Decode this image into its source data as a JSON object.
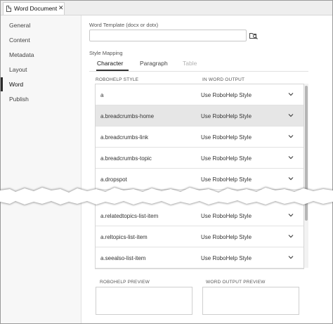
{
  "window": {
    "tab_title": "Word Document",
    "close_glyph": "✕"
  },
  "sidebar": {
    "items": [
      {
        "label": "General",
        "active": false
      },
      {
        "label": "Content",
        "active": false
      },
      {
        "label": "Metadata",
        "active": false
      },
      {
        "label": "Layout",
        "active": false
      },
      {
        "label": "Word",
        "active": true
      },
      {
        "label": "Publish",
        "active": false
      }
    ]
  },
  "template": {
    "label": "Word Template (docx or dotx)",
    "value": "",
    "browse_icon": "browse-folder-icon"
  },
  "style_mapping": {
    "label": "Style Mapping",
    "tabs": [
      {
        "label": "Character",
        "state": "active"
      },
      {
        "label": "Paragraph",
        "state": "inactive"
      },
      {
        "label": "Table",
        "state": "disabled"
      }
    ],
    "columns": [
      "ROBOHELP STYLE",
      "IN WORD OUTPUT"
    ],
    "rows": [
      {
        "style": "a",
        "output": "Use RoboHelp Style",
        "selected": false
      },
      {
        "style": "a.breadcrumbs-home",
        "output": "Use RoboHelp Style",
        "selected": true
      },
      {
        "style": "a.breadcrumbs-link",
        "output": "Use RoboHelp Style",
        "selected": false
      },
      {
        "style": "a.breadcrumbs-topic",
        "output": "Use RoboHelp Style",
        "selected": false
      },
      {
        "style": "a.dropspot",
        "output": "Use RoboHelp Style",
        "selected": false
      },
      {
        "style": "a.relatedtopics-list-item",
        "output": "Use RoboHelp Style",
        "selected": false
      },
      {
        "style": "a.reltopics-list-item",
        "output": "Use RoboHelp Style",
        "selected": false
      },
      {
        "style": "a.seealso-list-item",
        "output": "Use RoboHelp Style",
        "selected": false
      }
    ]
  },
  "preview": {
    "robohelp_label": "ROBOHELP PREVIEW",
    "word_label": "WORD OUTPUT PREVIEW"
  },
  "colors": {
    "selected_row": "#e6e6e6",
    "active_indicator": "#2b2b2b",
    "sidebar_bg": "#f7f7f7"
  }
}
